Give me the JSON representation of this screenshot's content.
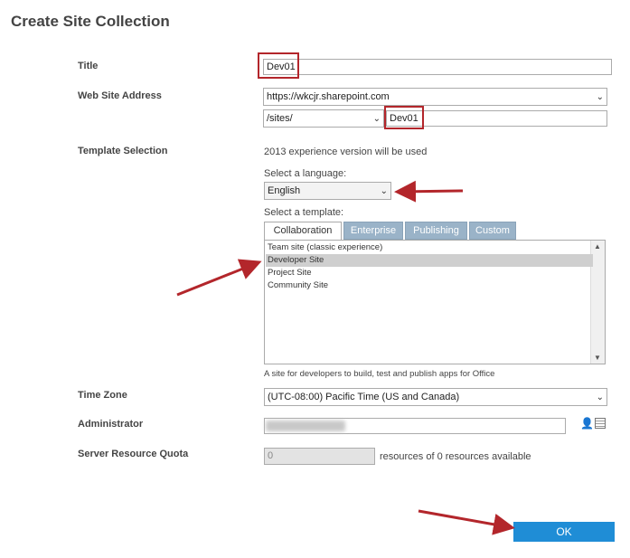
{
  "dialog": {
    "title": "Create Site Collection"
  },
  "labels": {
    "title": "Title",
    "web_site_address": "Web Site Address",
    "template_selection": "Template Selection",
    "time_zone": "Time Zone",
    "administrator": "Administrator",
    "server_resource_quota": "Server Resource Quota"
  },
  "fields": {
    "title_value": "Dev01",
    "web_app": "https://wkcjr.sharepoint.com",
    "path_prefix": "/sites/",
    "url_name": "Dev01"
  },
  "template": {
    "experience_note": "2013 experience version will be used",
    "language_label": "Select a language:",
    "language_value": "English",
    "template_label": "Select a template:",
    "tabs": [
      "Collaboration",
      "Enterprise",
      "Publishing",
      "Custom"
    ],
    "active_tab": "Collaboration",
    "items": [
      "Team site (classic experience)",
      "Developer Site",
      "Project Site",
      "Community Site"
    ],
    "selected_item": "Developer Site",
    "description": "A site for developers to build, test and publish apps for Office"
  },
  "time_zone": {
    "value": "(UTC-08:00) Pacific Time (US and Canada)"
  },
  "quota": {
    "value": "0",
    "suffix": "resources of 0 resources available"
  },
  "ok_button": {
    "label": "OK"
  },
  "colors": {
    "highlight": "#b3262b",
    "ok_button": "#1f8dd6",
    "tab_inactive": "#9ab3c8"
  }
}
